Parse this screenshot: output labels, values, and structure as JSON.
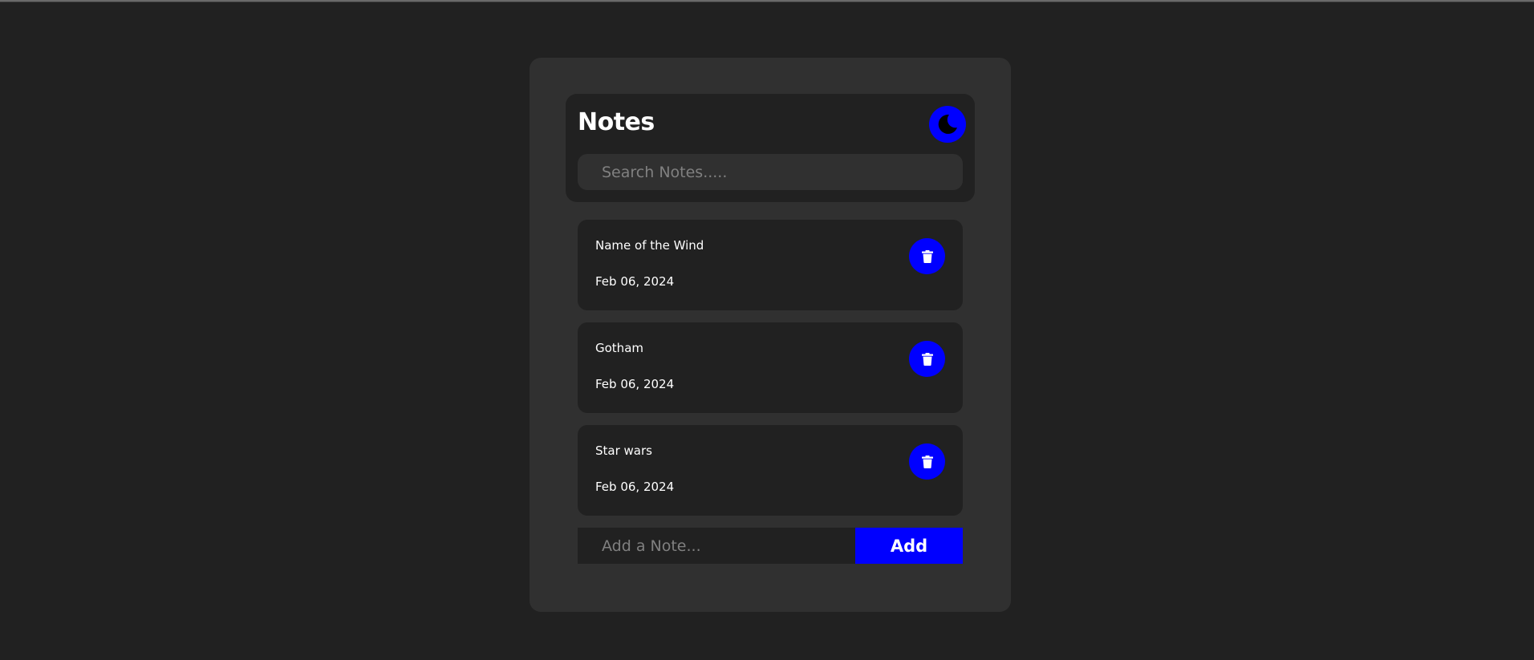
{
  "header": {
    "title": "Notes",
    "theme_toggle_icon": "moon-icon",
    "search_placeholder": "Search Notes....."
  },
  "notes": [
    {
      "title": "Name of the Wind",
      "date": "Feb 06, 2024",
      "delete_icon": "trash-icon"
    },
    {
      "title": "Gotham",
      "date": "Feb 06, 2024",
      "delete_icon": "trash-icon"
    },
    {
      "title": "Star wars",
      "date": "Feb 06, 2024",
      "delete_icon": "trash-icon"
    }
  ],
  "add_note": {
    "placeholder": "Add a Note...",
    "button_label": "Add"
  },
  "colors": {
    "background": "#212121",
    "card": "#303030",
    "accent": "#0000ff",
    "text": "#ffffff"
  }
}
